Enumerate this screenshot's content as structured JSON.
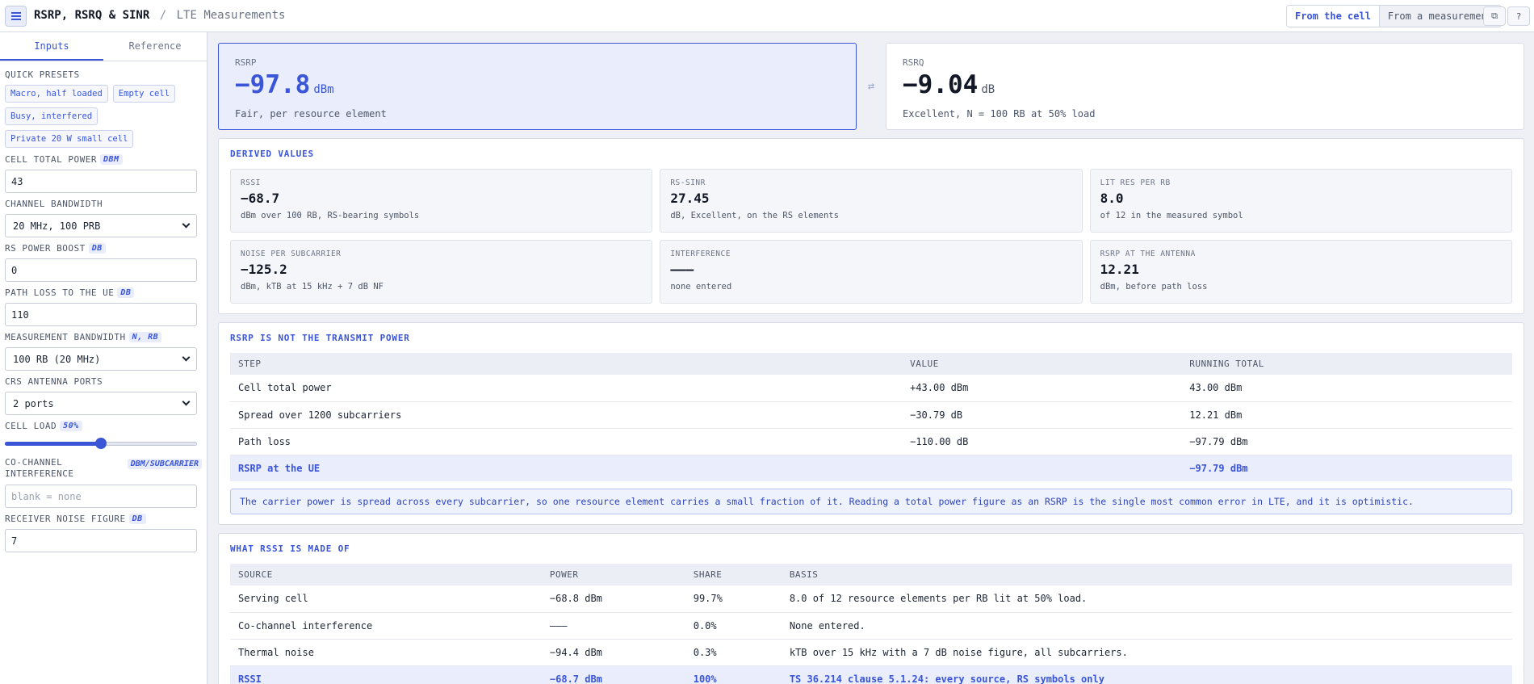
{
  "header": {
    "title": "RSRP, RSRQ & SINR",
    "separator": "/",
    "subtitle": "LTE Measurements",
    "modes": [
      "From the cell",
      "From a measurement"
    ],
    "active_mode": 0,
    "copy_glyph": "⧉",
    "help_glyph": "?"
  },
  "icons": {
    "menu": "hamburger-menu-icon",
    "copy": "copy-icon",
    "help": "help-icon",
    "swap": "swap-arrows-icon"
  },
  "sidebar": {
    "tabs": [
      "Inputs",
      "Reference"
    ],
    "active_tab": 0,
    "presets_label": "Quick presets",
    "presets": [
      "Macro, half loaded",
      "Empty cell",
      "Busy, interfered",
      "Private 20 W small cell"
    ],
    "fields": {
      "cell_total_power": {
        "label": "Cell total power",
        "unit": "dBm",
        "value": "43"
      },
      "channel_bandwidth": {
        "label": "Channel bandwidth",
        "value": "20 MHz, 100 PRB"
      },
      "rs_power_boost": {
        "label": "RS power boost",
        "unit": "dB",
        "value": "0"
      },
      "path_loss": {
        "label": "Path loss to the UE",
        "unit": "dB",
        "value": "110"
      },
      "measurement_bandwidth": {
        "label": "Measurement bandwidth",
        "unit": "N, RB",
        "value": "100 RB (20 MHz)"
      },
      "crs_ports": {
        "label": "CRS antenna ports",
        "value": "2 ports"
      },
      "cell_load": {
        "label": "Cell load",
        "unit": "50%",
        "fraction": 0.5
      },
      "cochannel_interference": {
        "label": "Co-channel interference",
        "unit": "dBm/subcarrier",
        "placeholder": "blank = none"
      },
      "noise_figure": {
        "label": "Receiver noise figure",
        "unit": "dB",
        "value": "7"
      }
    }
  },
  "hero": {
    "rsrp": {
      "key": "RSRP",
      "value": "−97.8",
      "unit": "dBm",
      "desc": "Fair, per resource element"
    },
    "swap_glyph": "⇄",
    "rsrq": {
      "key": "RSRQ",
      "value": "−9.04",
      "unit": "dB",
      "desc": "Excellent, N = 100 RB at 50% load"
    }
  },
  "derived": {
    "title": "Derived values",
    "cells": [
      {
        "key": "RSSI",
        "value": "−68.7",
        "desc": "dBm over 100 RB, RS-bearing symbols"
      },
      {
        "key": "RS-SINR",
        "value": "27.45",
        "desc": "dB, Excellent, on the RS elements"
      },
      {
        "key": "Lit REs per RB",
        "value": "8.0",
        "desc": "of 12 in the measured symbol"
      },
      {
        "key": "Noise per subcarrier",
        "value": "−125.2",
        "desc": "dBm, kTB at 15 kHz + 7 dB NF"
      },
      {
        "key": "Interference",
        "value": "———",
        "desc": "none entered"
      },
      {
        "key": "RSRP at the antenna",
        "value": "12.21",
        "desc": "dBm, before path loss"
      }
    ]
  },
  "transmit": {
    "title": "RSRP is not the transmit power",
    "columns": [
      "Step",
      "Value",
      "Running total"
    ],
    "rows": [
      [
        "Cell total power",
        "+43.00 dBm",
        "43.00 dBm"
      ],
      [
        "Spread over 1200 subcarriers",
        "−30.79 dB",
        "12.21 dBm"
      ],
      [
        "Path loss",
        "−110.00 dB",
        "−97.79 dBm"
      ],
      [
        "RSRP at the UE",
        "",
        "−97.79 dBm"
      ]
    ],
    "note": "The carrier power is spread across every subcarrier, so one resource element carries a small fraction of it. Reading a total power figure as an RSRP is the single most common error in LTE, and it is optimistic."
  },
  "rssi": {
    "title": "What RSSI is made of",
    "columns": [
      "Source",
      "Power",
      "Share",
      "Basis"
    ],
    "rows": [
      [
        "Serving cell",
        "−68.8 dBm",
        "99.7%",
        "8.0 of 12 resource elements per RB lit at 50% load."
      ],
      [
        "Co-channel interference",
        "———",
        "0.0%",
        "None entered."
      ],
      [
        "Thermal noise",
        "−94.4 dBm",
        "0.3%",
        "kTB over 15 kHz with a 7 dB noise figure, all subcarriers."
      ],
      [
        "RSSI",
        "−68.7 dBm",
        "100%",
        "TS 36.214 clause 5.1.24: every source, RS symbols only"
      ]
    ]
  }
}
